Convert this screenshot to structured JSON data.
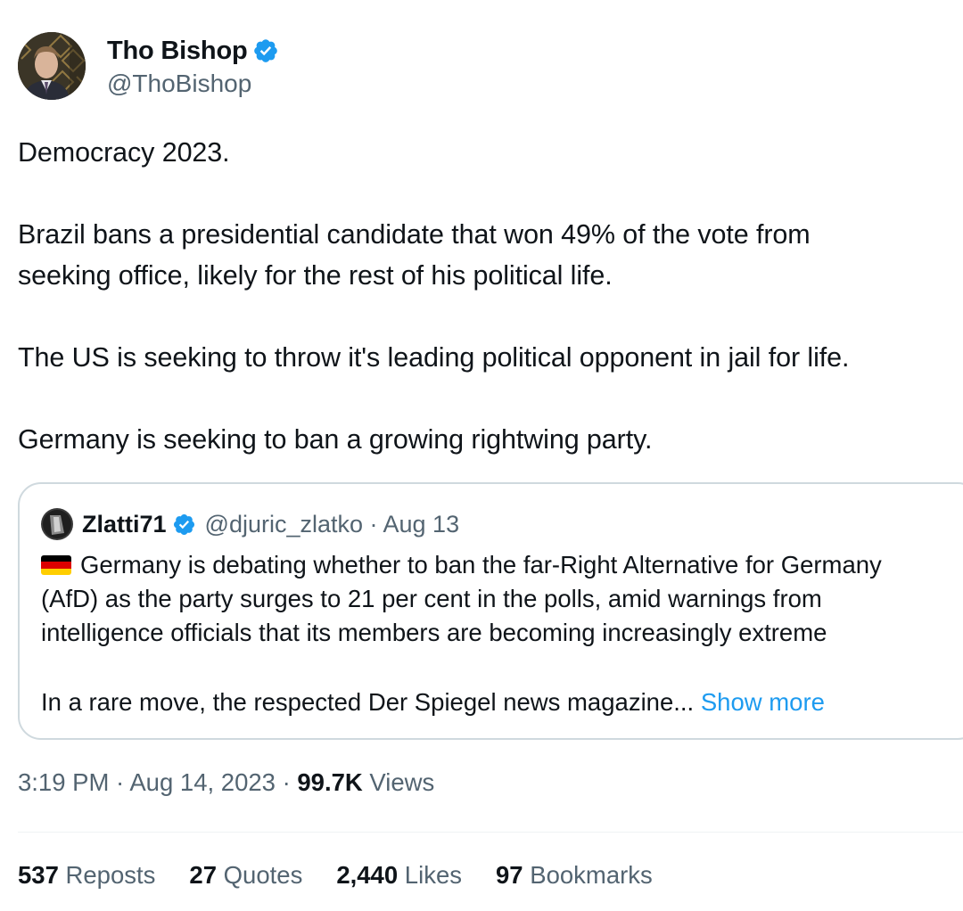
{
  "author": {
    "display_name": "Tho Bishop",
    "handle": "@ThoBishop",
    "verified_icon": "verified-badge-icon"
  },
  "tweet": {
    "paragraphs": [
      "Democracy 2023.",
      "Brazil bans a presidential candidate that won 49% of the vote from",
      "seeking office, likely for the rest of his political life.",
      "The US is seeking to throw it's leading political opponent in jail for life.",
      "Germany is seeking to ban a growing rightwing party."
    ]
  },
  "quote": {
    "display_name": "Zlatti71",
    "handle_date": "@djuric_zlatko · Aug 13",
    "lines": [
      "Germany is debating whether to ban the far-Right Alternative for Germany",
      "(AfD) as the party surges to 21 per cent in the polls, amid warnings from",
      "intelligence officials that its members are becoming increasingly extreme",
      "In a rare move, the respected Der Spiegel news magazine..."
    ],
    "flag_icon": "germany-flag-icon",
    "show_more": "Show more"
  },
  "meta": {
    "time_date": "3:19 PM · Aug 14, 2023 · ",
    "views_count": "99.7K",
    "views_label": " Views"
  },
  "stats": {
    "reposts_count": "537",
    "reposts_label": " Reposts",
    "quotes_count": "27",
    "quotes_label": " Quotes",
    "likes_count": "2,440",
    "likes_label": " Likes",
    "bookmarks_count": "97",
    "bookmarks_label": " Bookmarks"
  },
  "colors": {
    "accent": "#1d9bf0",
    "text": "#0f1419",
    "secondary": "#536471",
    "border": "#cfd9de"
  }
}
